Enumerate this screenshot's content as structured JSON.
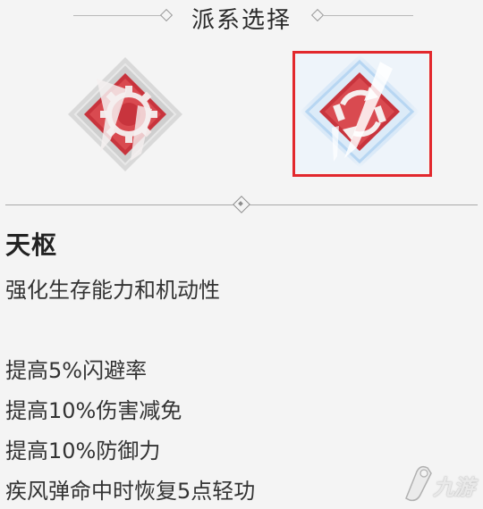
{
  "header": {
    "title": "派系选择"
  },
  "factions": [
    {
      "id": "left",
      "icon": "gear-emblem-icon",
      "selected": false
    },
    {
      "id": "right",
      "icon": "circular-arrows-emblem-icon",
      "selected": true
    }
  ],
  "detail": {
    "name": "天枢",
    "tagline": "强化生存能力和机动性",
    "bonuses": [
      "提高5%闪避率",
      "提高10%伤害减免",
      "提高10%防御力",
      "疾风弹命中时恢复5点轻功"
    ]
  },
  "watermark": {
    "text": "九游"
  },
  "colors": {
    "selection_frame": "#e2282d",
    "emblem_red": "#c8343d",
    "selected_glow": "#a9cdef"
  }
}
